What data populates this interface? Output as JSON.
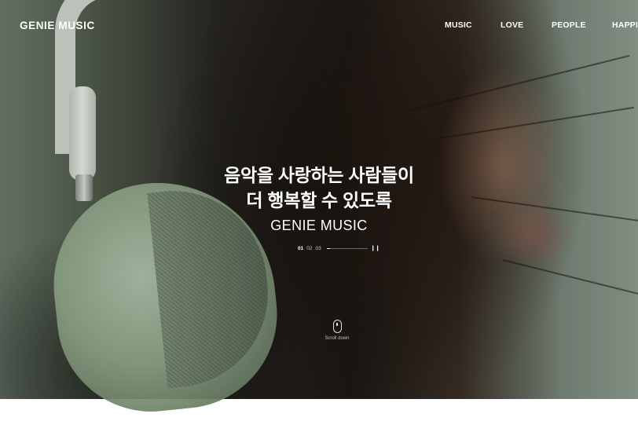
{
  "header": {
    "logo": "GENIE MUSIC",
    "nav": [
      "MUSIC",
      "LOVE",
      "PEOPLE",
      "HAPPI"
    ]
  },
  "hero": {
    "headline_line1": "음악을 사랑하는 사람들이",
    "headline_line2": "더 행복할 수 있도록",
    "subtitle": "GENIE MUSIC",
    "pager": {
      "slides": [
        "01",
        "02",
        "03"
      ],
      "active_index": 0,
      "progress": 0.08,
      "pause_icon": "pause-icon"
    },
    "scroll_label": "Scroll down",
    "scroll_icon": "mouse-icon"
  },
  "colors": {
    "text": "#ffffff",
    "background_green": "#93a294"
  }
}
